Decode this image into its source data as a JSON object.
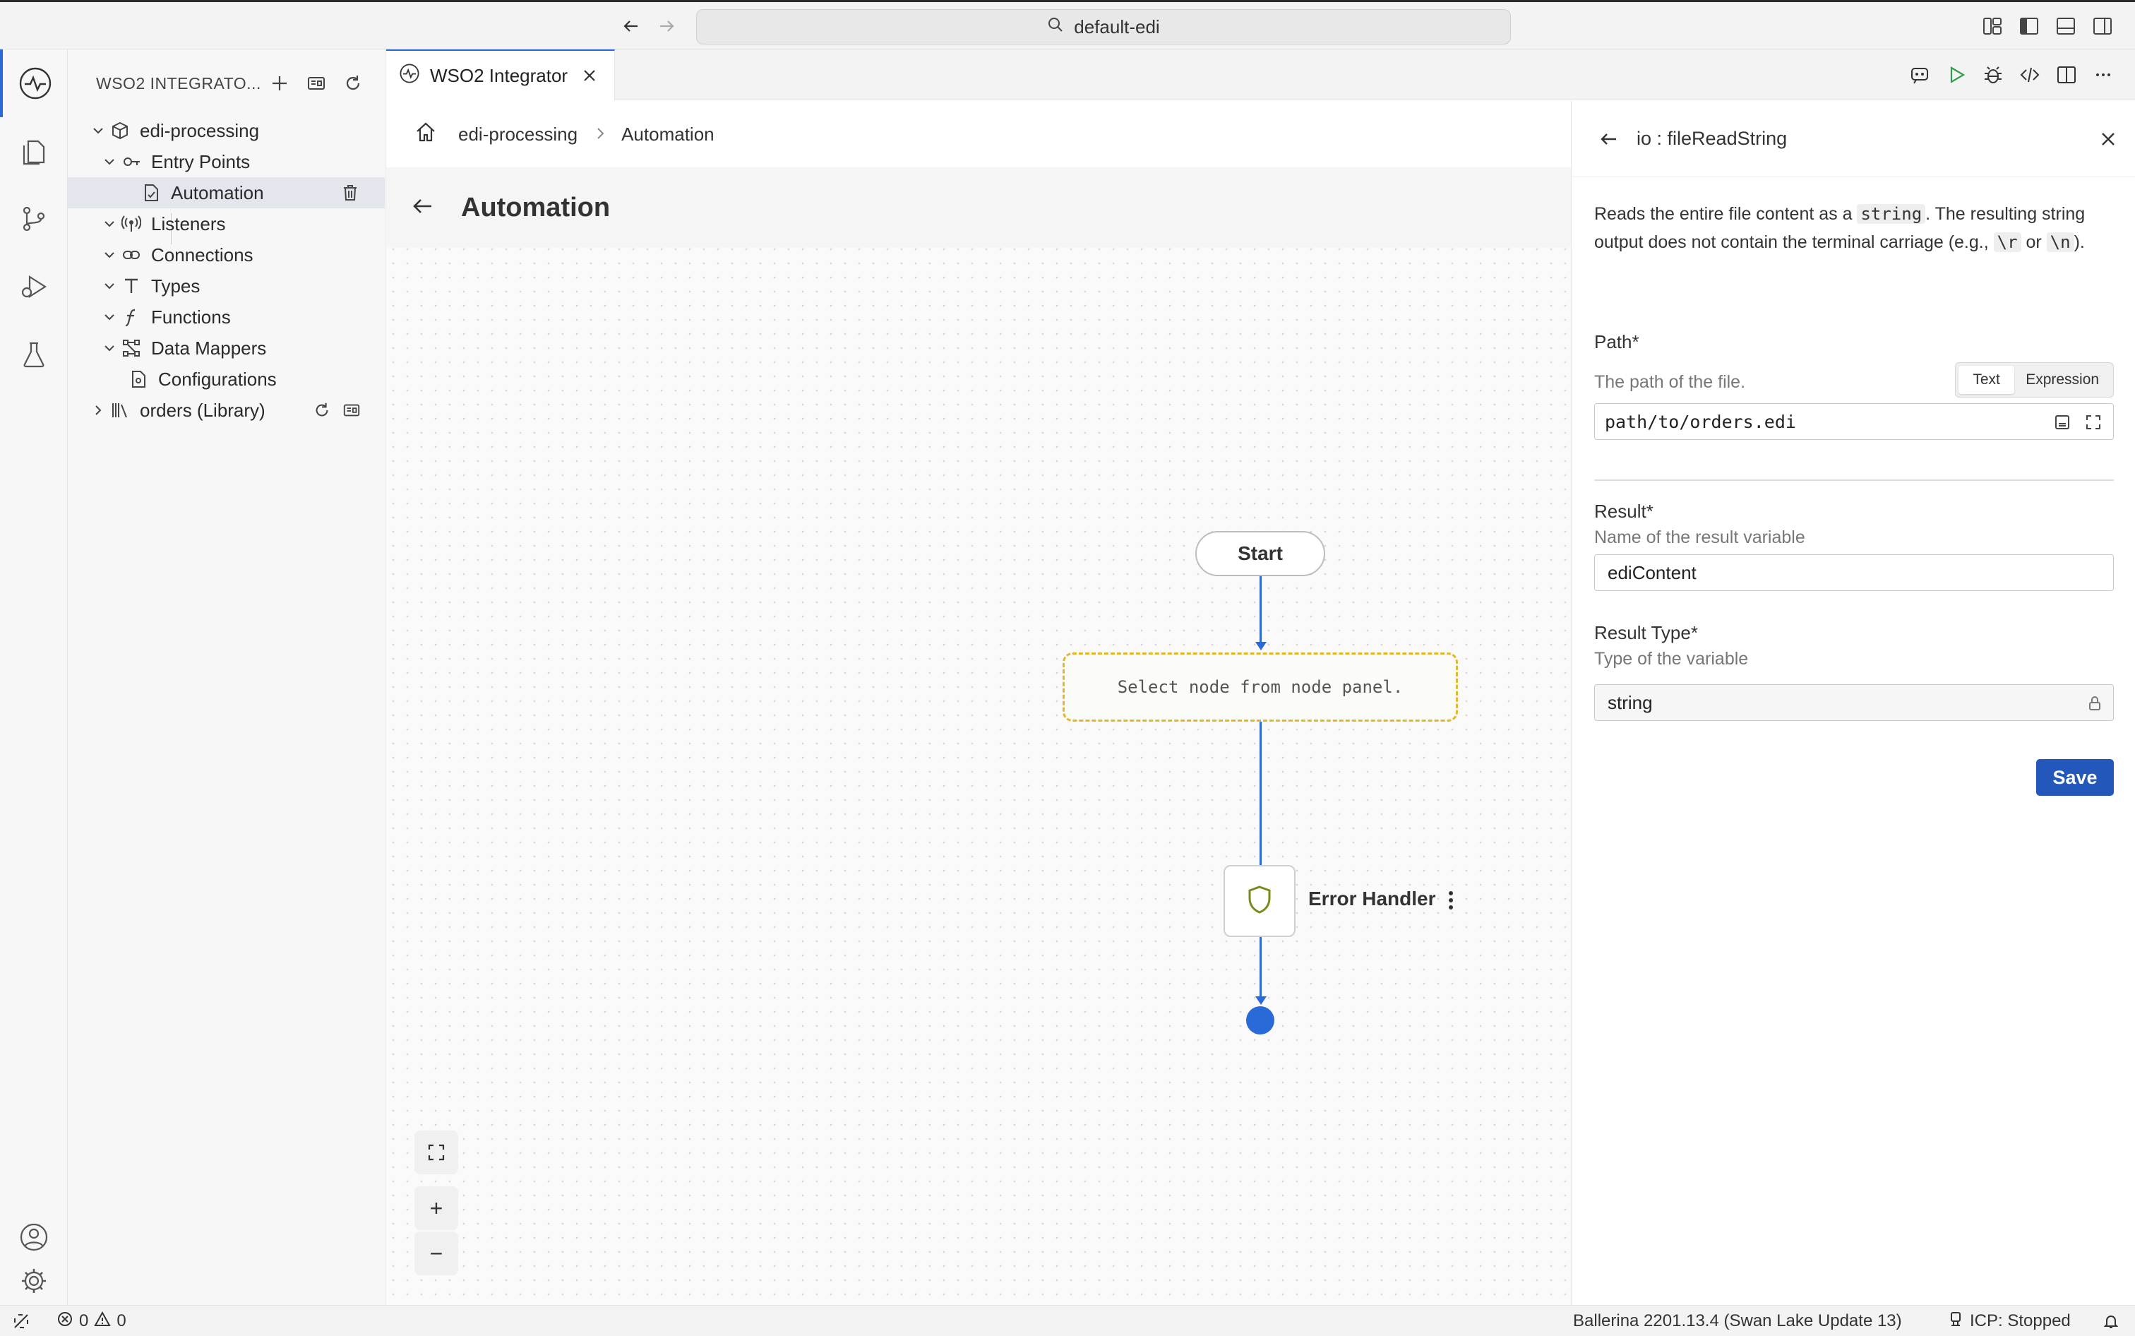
{
  "titlebar": {
    "search_text": "default-edi",
    "back_label": "←",
    "forward_label": "→"
  },
  "sidebar": {
    "title": "WSO2 INTEGRATO...",
    "project": "edi-processing",
    "items": [
      {
        "label": "Entry Points"
      },
      {
        "label": "Automation"
      },
      {
        "label": "Listeners"
      },
      {
        "label": "Connections"
      },
      {
        "label": "Types"
      },
      {
        "label": "Functions"
      },
      {
        "label": "Data Mappers"
      },
      {
        "label": "Configurations"
      }
    ],
    "library": "orders (Library)"
  },
  "tab": {
    "label": "WSO2 Integrator"
  },
  "breadcrumb": {
    "project": "edi-processing",
    "current": "Automation"
  },
  "page": {
    "title": "Automation"
  },
  "flow": {
    "start_label": "Start",
    "placeholder_text": "Select node from node panel.",
    "error_handler_label": "Error Handler"
  },
  "zoom": {
    "zoom_in": "+",
    "zoom_out": "−"
  },
  "panel": {
    "title": "io : fileReadString",
    "description": {
      "part1": "Reads the entire file content as a ",
      "code1": "string",
      "part2": ". The resulting string output does not contain the terminal carriage (e.g., ",
      "code2": "\\r",
      "part3": " or ",
      "code3": "\\n",
      "part4": ")."
    },
    "path": {
      "label": "Path*",
      "sublabel": "The path of the file.",
      "mode_text": "Text",
      "mode_expression": "Expression",
      "value": "path/to/orders.edi"
    },
    "result": {
      "label": "Result*",
      "sublabel": "Name of the result variable",
      "value": "ediContent"
    },
    "result_type": {
      "label": "Result Type*",
      "sublabel": "Type of the variable",
      "value": "string"
    },
    "save_label": "Save"
  },
  "statusbar": {
    "errors": "0",
    "warnings": "0",
    "ballerina": "Ballerina 2201.13.4 (Swan Lake Update 13)",
    "icp": "ICP: Stopped"
  },
  "colors": {
    "accent": "#2a6ad8",
    "save_button": "#2357ba",
    "placeholder_border": "#e6b629",
    "shield": "#7a8a1a"
  }
}
